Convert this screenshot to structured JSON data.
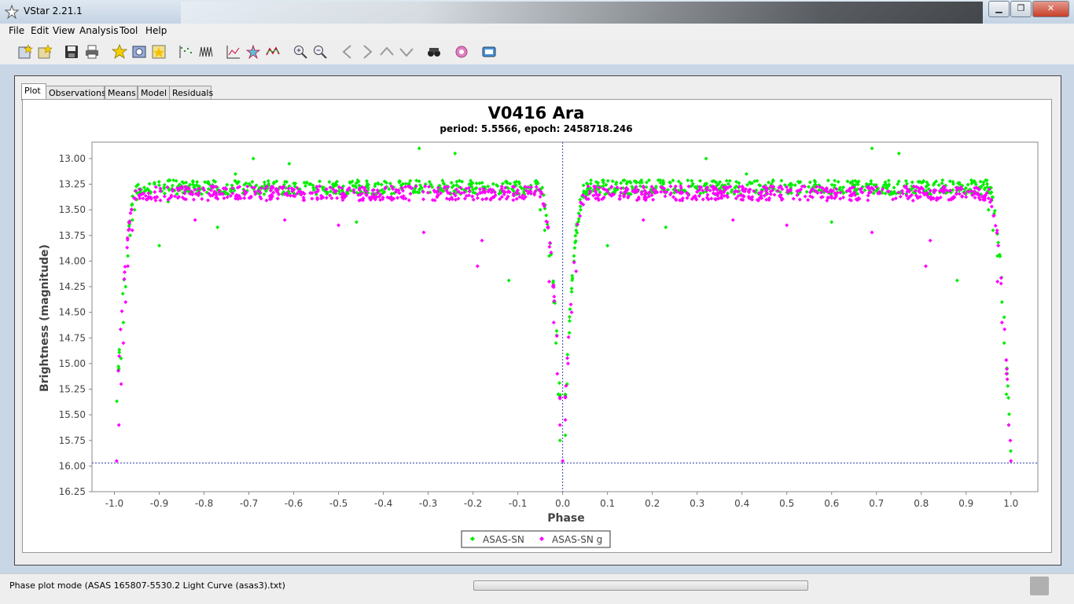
{
  "window": {
    "title": "VStar 2.21.1",
    "minimize": "▁",
    "maximize": "❐",
    "close": "✕"
  },
  "menu": [
    "File",
    "Edit",
    "View",
    "Analysis",
    "Tool",
    "Help"
  ],
  "toolbar_icons": [
    "new-star-file-icon",
    "new-star-database-icon",
    "save-icon",
    "print-icon",
    "star-info-icon",
    "observation-details-icon",
    "filter-icon",
    "mean-series-icon",
    "period-search-icon",
    "phase-plot-icon",
    "model-icon",
    "polynomial-fit-icon",
    "zoom-in-icon",
    "zoom-out-icon",
    "pan-left-icon",
    "pan-right-icon",
    "pan-up-icon",
    "pan-down-icon",
    "binoculars-icon",
    "plugin-icon",
    "info-icon"
  ],
  "tabs": [
    "Plot",
    "Observations",
    "Means",
    "Model",
    "Residuals"
  ],
  "colors": {
    "series_green": "#00ee00",
    "series_magenta": "#ff00ff",
    "accent": "#2f5cc0"
  },
  "chart_data": {
    "type": "scatter",
    "title": "V0416 Ara",
    "subtitle": "period: 5.5566, epoch: 2458718.246",
    "xlabel": "Phase",
    "ylabel": "Brightness (magnitude)",
    "xlim": [
      -1.05,
      1.06
    ],
    "ylim": [
      16.25,
      12.84
    ],
    "y_inverted": true,
    "x_ticks": [
      "-1.0",
      "-0.9",
      "-0.8",
      "-0.7",
      "-0.6",
      "-0.5",
      "-0.4",
      "-0.3",
      "-0.2",
      "-0.1",
      "0.0",
      "0.1",
      "0.2",
      "0.3",
      "0.4",
      "0.5",
      "0.6",
      "0.7",
      "0.8",
      "0.9",
      "1.0"
    ],
    "y_ticks": [
      "13.00",
      "13.25",
      "13.50",
      "13.75",
      "14.00",
      "14.25",
      "14.50",
      "14.75",
      "15.00",
      "15.25",
      "15.50",
      "15.75",
      "16.00",
      "16.25"
    ],
    "crosshair": {
      "x": 0.0,
      "y": 15.97
    },
    "series": [
      {
        "name": "ASAS-SN",
        "color": "#00ee00",
        "baseline": 13.28,
        "points": [
          [
            -0.99,
            15.05
          ],
          [
            -0.985,
            14.95
          ],
          [
            -0.98,
            14.6
          ],
          [
            -0.975,
            14.25
          ],
          [
            -0.97,
            13.95
          ],
          [
            -0.965,
            13.75
          ],
          [
            -0.96,
            13.6
          ],
          [
            -0.955,
            13.5
          ],
          [
            -0.95,
            13.4
          ],
          [
            -0.9,
            13.85
          ],
          [
            -0.88,
            13.42
          ],
          [
            -0.77,
            13.67
          ],
          [
            -0.73,
            13.15
          ],
          [
            -0.69,
            13.0
          ],
          [
            -0.61,
            13.05
          ],
          [
            -0.46,
            13.62
          ],
          [
            -0.32,
            12.9
          ],
          [
            -0.24,
            12.95
          ],
          [
            -0.12,
            14.19
          ],
          [
            -0.05,
            13.5
          ],
          [
            -0.04,
            13.7
          ],
          [
            -0.03,
            13.95
          ],
          [
            -0.02,
            14.4
          ],
          [
            -0.015,
            14.8
          ],
          [
            -0.01,
            15.3
          ],
          [
            -0.006,
            15.75
          ],
          [
            0.006,
            15.7
          ],
          [
            0.01,
            15.2
          ],
          [
            0.015,
            14.7
          ],
          [
            0.02,
            14.3
          ],
          [
            0.025,
            13.95
          ],
          [
            0.03,
            13.7
          ],
          [
            0.04,
            13.5
          ],
          [
            0.1,
            13.85
          ],
          [
            0.23,
            13.67
          ],
          [
            0.32,
            13.0
          ],
          [
            0.41,
            13.15
          ],
          [
            0.6,
            13.62
          ],
          [
            0.69,
            12.9
          ],
          [
            0.75,
            12.95
          ],
          [
            0.88,
            14.19
          ],
          [
            0.95,
            13.5
          ],
          [
            0.96,
            13.7
          ],
          [
            0.97,
            13.95
          ],
          [
            0.98,
            14.4
          ],
          [
            0.985,
            14.8
          ],
          [
            0.99,
            15.3
          ],
          [
            0.995,
            15.6
          ]
        ]
      },
      {
        "name": "ASAS-SN g",
        "color": "#ff00ff",
        "baseline": 13.34,
        "points": [
          [
            -0.995,
            15.95
          ],
          [
            -0.99,
            15.6
          ],
          [
            -0.985,
            15.2
          ],
          [
            -0.98,
            14.8
          ],
          [
            -0.975,
            14.4
          ],
          [
            -0.97,
            14.05
          ],
          [
            -0.96,
            13.7
          ],
          [
            -0.82,
            13.6
          ],
          [
            -0.62,
            13.6
          ],
          [
            -0.5,
            13.65
          ],
          [
            -0.31,
            13.72
          ],
          [
            -0.19,
            14.05
          ],
          [
            -0.18,
            13.8
          ],
          [
            -0.03,
            14.2
          ],
          [
            -0.02,
            14.6
          ],
          [
            -0.012,
            15.1
          ],
          [
            -0.006,
            15.6
          ],
          [
            0.0,
            15.95
          ],
          [
            0.006,
            15.55
          ],
          [
            0.012,
            15.0
          ],
          [
            0.02,
            14.5
          ],
          [
            0.03,
            14.1
          ],
          [
            0.18,
            13.6
          ],
          [
            0.38,
            13.6
          ],
          [
            0.5,
            13.65
          ],
          [
            0.69,
            13.72
          ],
          [
            0.81,
            14.05
          ],
          [
            0.82,
            13.8
          ],
          [
            0.97,
            14.2
          ],
          [
            0.98,
            14.6
          ],
          [
            0.99,
            15.1
          ],
          [
            0.995,
            15.6
          ],
          [
            1.0,
            15.95
          ]
        ]
      }
    ],
    "legend": {
      "placement": "bottom-center",
      "items": [
        "ASAS-SN",
        "ASAS-SN g"
      ]
    }
  },
  "status": {
    "text": "Phase plot mode (ASAS 165807-5530.2 Light Curve (asas3).txt)"
  }
}
